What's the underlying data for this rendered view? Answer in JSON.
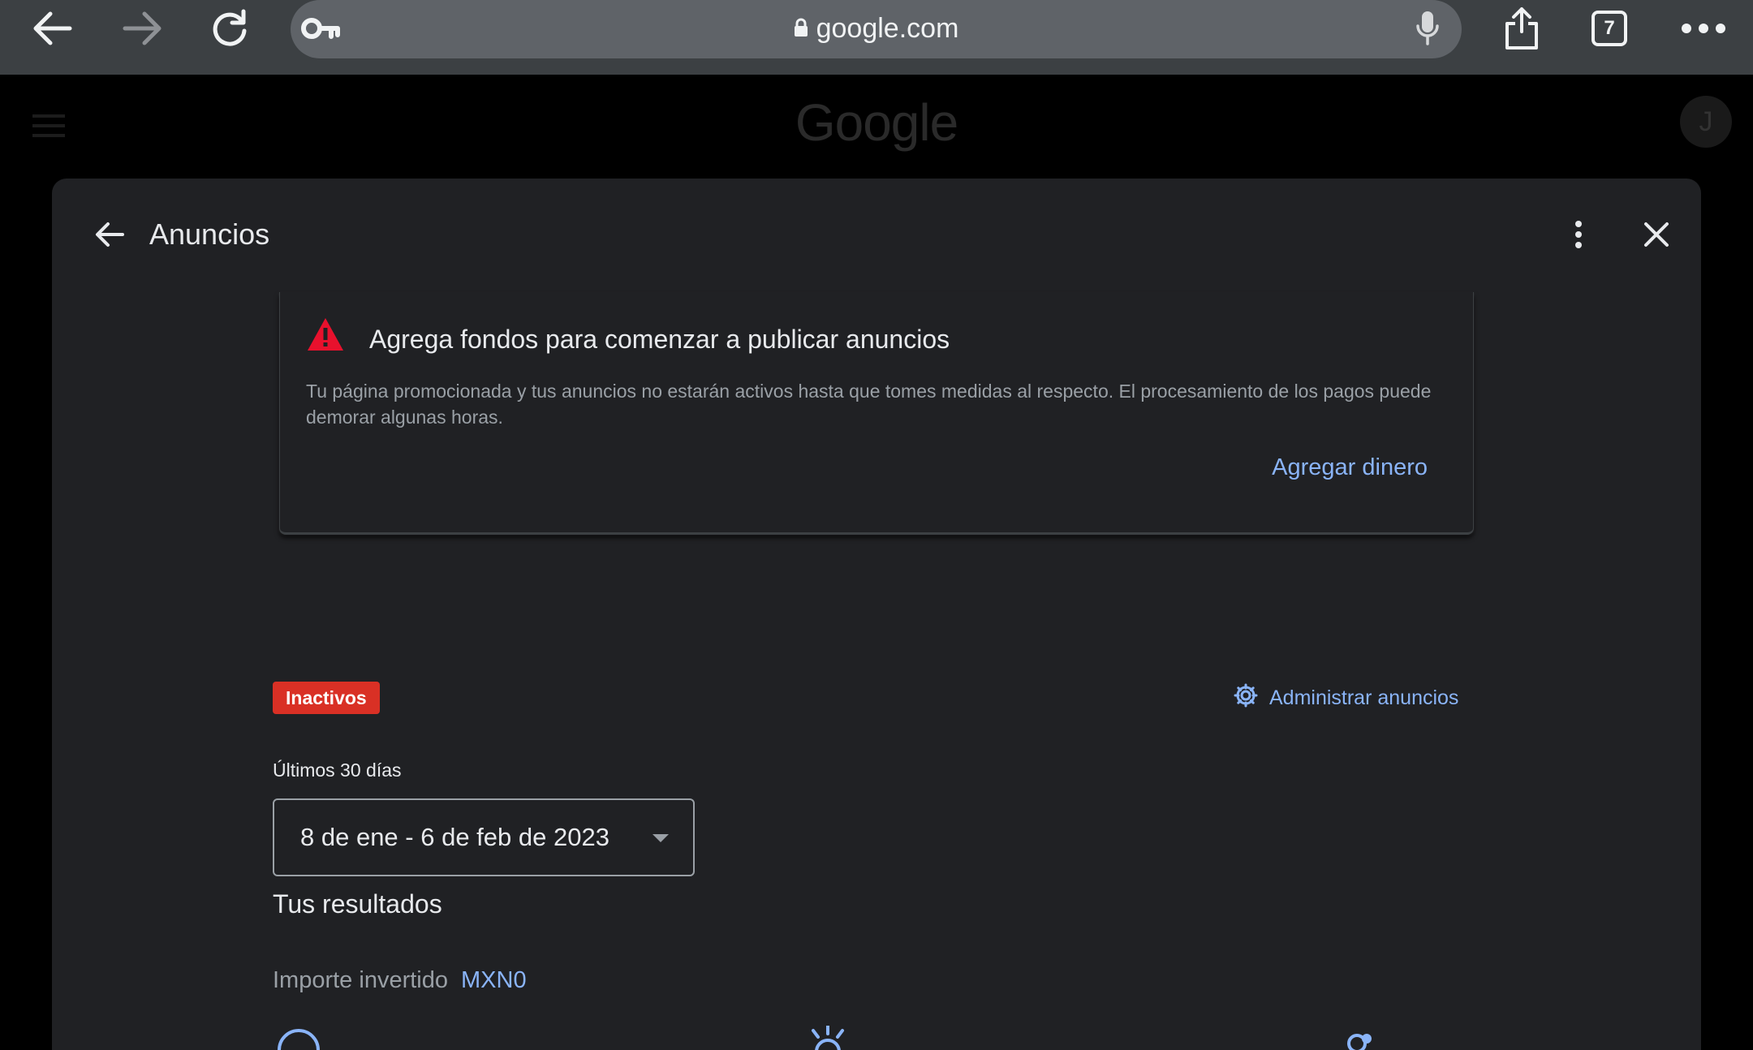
{
  "browser": {
    "url": "google.com",
    "tab_count": "7"
  },
  "background_page": {
    "logo": "Google",
    "avatar_initial": "J"
  },
  "dialog": {
    "title": "Anuncios",
    "alert": {
      "title": "Agrega fondos para comenzar a publicar anuncios",
      "body": "Tu página promocionada y tus anuncios no estarán activos hasta que tomes medidas al respecto. El procesamiento de los pagos puede demorar algunas horas.",
      "action": "Agregar dinero"
    },
    "status_badge": "Inactivos",
    "manage_link": "Administrar anuncios",
    "period_label": "Últimos 30 días",
    "date_range": "8 de ene - 6 de feb de 2023",
    "results_title": "Tus resultados",
    "spend_label": "Importe invertido",
    "spend_value": "MXN0"
  },
  "colors": {
    "toolbar": "#3c4043",
    "dialog_bg": "#202124",
    "link": "#8ab4f8",
    "badge": "#d93025",
    "warning": "#e8112d"
  }
}
